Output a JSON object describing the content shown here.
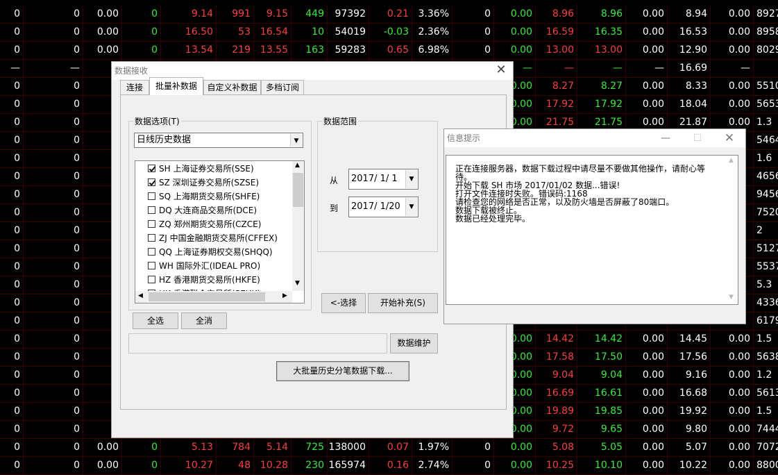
{
  "background": {
    "rows": [
      [
        "0",
        "0",
        "0.00",
        "0",
        "9.14",
        "991",
        "9.15",
        "449",
        "97392",
        "0.21",
        "3.36%",
        "0",
        "0.00",
        "8.96",
        "8.96",
        "0.00",
        "8.94",
        "0.00",
        "8927"
      ],
      [
        "0",
        "0",
        "0.00",
        "0",
        "16.50",
        "53",
        "16.54",
        "10",
        "54019",
        "-0.03",
        "2.36%",
        "0",
        "0.00",
        "16.59",
        "16.35",
        "0.00",
        "16.53",
        "0.00",
        "8958"
      ],
      [
        "0",
        "0",
        "0.00",
        "0",
        "13.54",
        "219",
        "13.55",
        "163",
        "59283",
        "0.65",
        "6.98%",
        "0",
        "0.00",
        "13.00",
        "13.00",
        "0.00",
        "12.90",
        "0.00",
        "8029"
      ],
      [
        "—",
        "—",
        "",
        "",
        "",
        "",
        "",
        "",
        "",
        "",
        "",
        "",
        "—",
        "—",
        "—",
        "—",
        "16.69",
        "—",
        ""
      ],
      [
        "0",
        "0",
        "",
        "",
        "",
        "",
        "",
        "",
        "",
        "",
        "",
        "",
        "0.00",
        "8.27",
        "8.27",
        "0.00",
        "8.33",
        "0.00",
        "5510"
      ],
      [
        "0",
        "0",
        "",
        "",
        "",
        "",
        "",
        "",
        "",
        "",
        "",
        "",
        "0.00",
        "17.92",
        "17.92",
        "0.00",
        "18.04",
        "0.00",
        "5653"
      ],
      [
        "0",
        "0",
        "",
        "",
        "",
        "",
        "",
        "",
        "",
        "",
        "",
        "",
        "0.00",
        "21.75",
        "21.75",
        "0.00",
        "21.87",
        "0.00",
        "1.3"
      ],
      [
        "0",
        "0",
        "",
        "",
        "",
        "",
        "",
        "",
        "",
        "",
        "",
        "",
        "",
        "",
        "",
        "",
        "",
        "",
        "5464"
      ],
      [
        "0",
        "0",
        "",
        "",
        "",
        "",
        "",
        "",
        "",
        "",
        "",
        "",
        "",
        "",
        "",
        "",
        "",
        "",
        "1.6"
      ],
      [
        "0",
        "0",
        "",
        "",
        "",
        "",
        "",
        "",
        "",
        "",
        "",
        "",
        "",
        "",
        "",
        "",
        "",
        "",
        "4656"
      ],
      [
        "0",
        "0",
        "",
        "",
        "",
        "",
        "",
        "",
        "",
        "",
        "",
        "",
        "",
        "",
        "",
        "",
        "",
        "",
        "9456"
      ],
      [
        "0",
        "0",
        "",
        "",
        "",
        "",
        "",
        "",
        "",
        "",
        "",
        "",
        "",
        "",
        "",
        "",
        "",
        "",
        "7520"
      ],
      [
        "0",
        "0",
        "",
        "",
        "",
        "",
        "",
        "",
        "",
        "",
        "",
        "",
        "",
        "",
        "",
        "",
        "",
        "",
        "2"
      ],
      [
        "0",
        "0",
        "",
        "",
        "",
        "",
        "",
        "",
        "",
        "",
        "",
        "",
        "",
        "",
        "",
        "",
        "",
        "",
        "5127"
      ],
      [
        "0",
        "0",
        "",
        "",
        "",
        "",
        "",
        "",
        "",
        "",
        "",
        "",
        "",
        "",
        "",
        "",
        "",
        "",
        "5537"
      ],
      [
        "0",
        "0",
        "",
        "",
        "",
        "",
        "",
        "",
        "",
        "",
        "",
        "",
        "",
        "",
        "",
        "",
        "",
        "",
        "5.3"
      ],
      [
        "0",
        "0",
        "",
        "",
        "",
        "",
        "",
        "",
        "",
        "",
        "",
        "",
        "",
        "",
        "",
        "",
        "",
        "",
        "4336"
      ],
      [
        "0",
        "0",
        "",
        "",
        "",
        "",
        "",
        "",
        "",
        "",
        "",
        "",
        "",
        "",
        "",
        "",
        "",
        "",
        "6179"
      ],
      [
        "0",
        "0",
        "",
        "",
        "",
        "",
        "",
        "",
        "",
        "",
        "",
        "",
        "0.00",
        "14.42",
        "14.42",
        "0.00",
        "14.45",
        "0.00",
        "1.5"
      ],
      [
        "0",
        "0",
        "",
        "",
        "",
        "",
        "",
        "",
        "",
        "",
        "",
        "",
        "0.00",
        "17.58",
        "17.50",
        "0.00",
        "17.56",
        "0.00",
        "5638"
      ],
      [
        "0",
        "0",
        "",
        "",
        "",
        "",
        "",
        "",
        "",
        "",
        "",
        "",
        "0.00",
        "9.04",
        "9.04",
        "0.00",
        "9.16",
        "0.00",
        "1.2"
      ],
      [
        "0",
        "0",
        "",
        "",
        "",
        "",
        "",
        "",
        "",
        "",
        "",
        "",
        "0.00",
        "16.69",
        "16.61",
        "0.00",
        "16.68",
        "0.00",
        "5613"
      ],
      [
        "0",
        "0",
        "",
        "",
        "",
        "",
        "",
        "",
        "",
        "",
        "",
        "",
        "0.00",
        "19.89",
        "19.85",
        "0.00",
        "19.92",
        "0.00",
        "1.5"
      ],
      [
        "0",
        "0",
        "",
        "",
        "",
        "",
        "",
        "",
        "",
        "",
        "",
        "",
        "0.00",
        "9.72",
        "9.65",
        "0.00",
        "9.80",
        "0.00",
        "7444"
      ],
      [
        "0",
        "0",
        "0.00",
        "0",
        "5.13",
        "784",
        "5.14",
        "725",
        "138000",
        "0.07",
        "1.97%",
        "0",
        "0.00",
        "5.08",
        "5.05",
        "0.00",
        "5.07",
        "0.00",
        "7072"
      ],
      [
        "0",
        "0",
        "0.00",
        "0",
        "10.27",
        "48",
        "10.28",
        "230",
        "165974",
        "0.16",
        "2.74%",
        "0",
        "0.00",
        "10.25",
        "10.10",
        "0.00",
        "10.22",
        "0.00",
        "8800"
      ]
    ]
  },
  "dialog": {
    "title": "数据接收",
    "close_glyph": "✕",
    "tabs": [
      "连接",
      "批量补数据",
      "自定义补数据",
      "多档订阅"
    ],
    "data_options_label": "数据选项(T)",
    "data_type_selected": "日线历史数据",
    "markets": [
      {
        "label": "SH 上海证券交易所(SSE)",
        "checked": true
      },
      {
        "label": "SZ 深圳证券交易所(SZSE)",
        "checked": true
      },
      {
        "label": "SQ 上海期货交易所(SHFE)",
        "checked": false
      },
      {
        "label": "DQ 大连商品交易所(DCE)",
        "checked": false
      },
      {
        "label": "ZQ 郑州期货交易所(CZCE)",
        "checked": false
      },
      {
        "label": "ZJ 中国金融期货交易所(CFFEX)",
        "checked": false
      },
      {
        "label": "QQ 上海证券期权交易(SHQQ)",
        "checked": false
      },
      {
        "label": "WH 国际外汇(IDEAL PRO)",
        "checked": false
      },
      {
        "label": "HZ 香港期货交易所(HKFE)",
        "checked": false
      },
      {
        "label": "HK 香港联合交易所(SEHK)",
        "checked": false
      }
    ],
    "select_all": "全选",
    "clear_all": "全消",
    "range_label": "数据范围",
    "from_label": "从",
    "to_label": "到",
    "from_date": "2017/  1/  1",
    "to_date": "2017/  1/20",
    "select_button": "<-选择",
    "start_button": "开始补充(S)",
    "maintain_button": "数据维护",
    "bulk_download_button": "大批量历史分笔数据下载..."
  },
  "info": {
    "title": "信息提示",
    "minimize_glyph": "—",
    "maximize_glyph": "☐",
    "close_glyph": "✕",
    "lines": [
      "正在连接服务器，数据下载过程中请尽量不要做其他操作，请耐心等",
      "待。",
      "开始下载 SH 市场 2017/01/02 数据...错误!",
      "打开文件连接时失败。错误码:1168",
      "请检查您的网络是否正常，以及防火墙是否屏蔽了80端口。",
      "数据下载被终止。",
      "数据已经处理完毕。"
    ]
  },
  "colors": {
    "grid_line": "#3a0000",
    "up": "#ff3c3c",
    "down": "#33ee33",
    "neutral": "#ffffff",
    "window_bg": "#f0f0f0"
  }
}
